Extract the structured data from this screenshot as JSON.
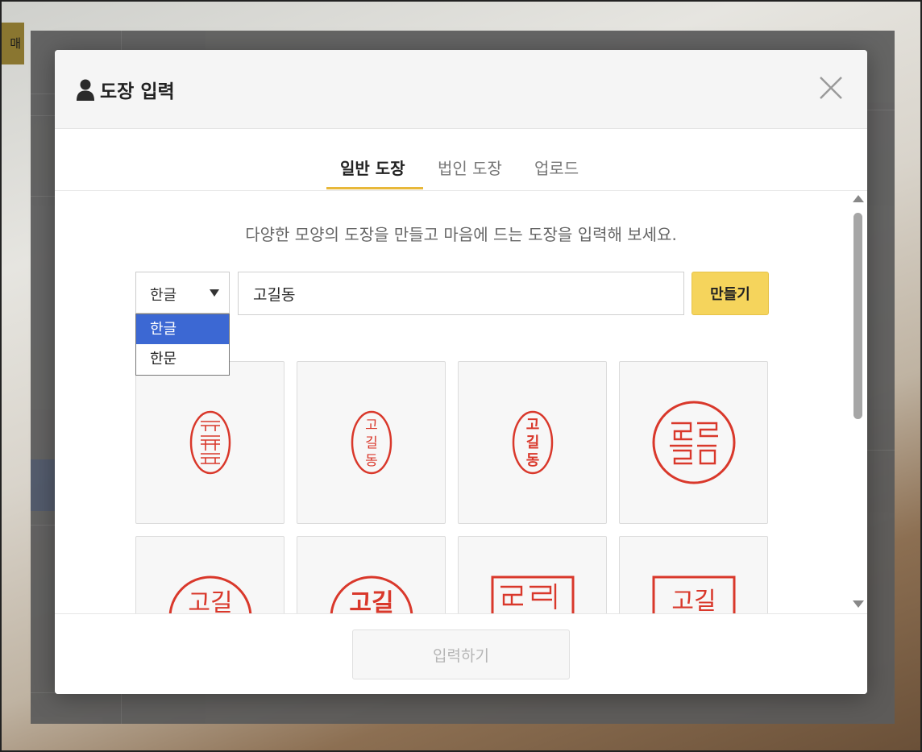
{
  "background": {
    "button_fragment": "매"
  },
  "modal": {
    "title": "도장 입력",
    "title_icon": "user-icon",
    "close_icon": "close-icon"
  },
  "tabs": [
    {
      "label": "일반 도장",
      "active": true
    },
    {
      "label": "법인 도장",
      "active": false
    },
    {
      "label": "업로드",
      "active": false
    }
  ],
  "description": "다양한 모양의 도장을 만들고 마음에 드는 도장을 입력해 보세요.",
  "script_select": {
    "value": "한글",
    "options": [
      {
        "label": "한글",
        "selected": true
      },
      {
        "label": "한문",
        "selected": false
      }
    ]
  },
  "name_input": {
    "value": "고길동"
  },
  "make_button": {
    "label": "만들기"
  },
  "stamp_name": "고길동",
  "footer": {
    "submit_label": "입력하기"
  },
  "colors": {
    "stamp": "#d9382b",
    "accent": "#e8b83a",
    "selected_option": "#3c68d3",
    "make_button": "#f5d45c"
  }
}
